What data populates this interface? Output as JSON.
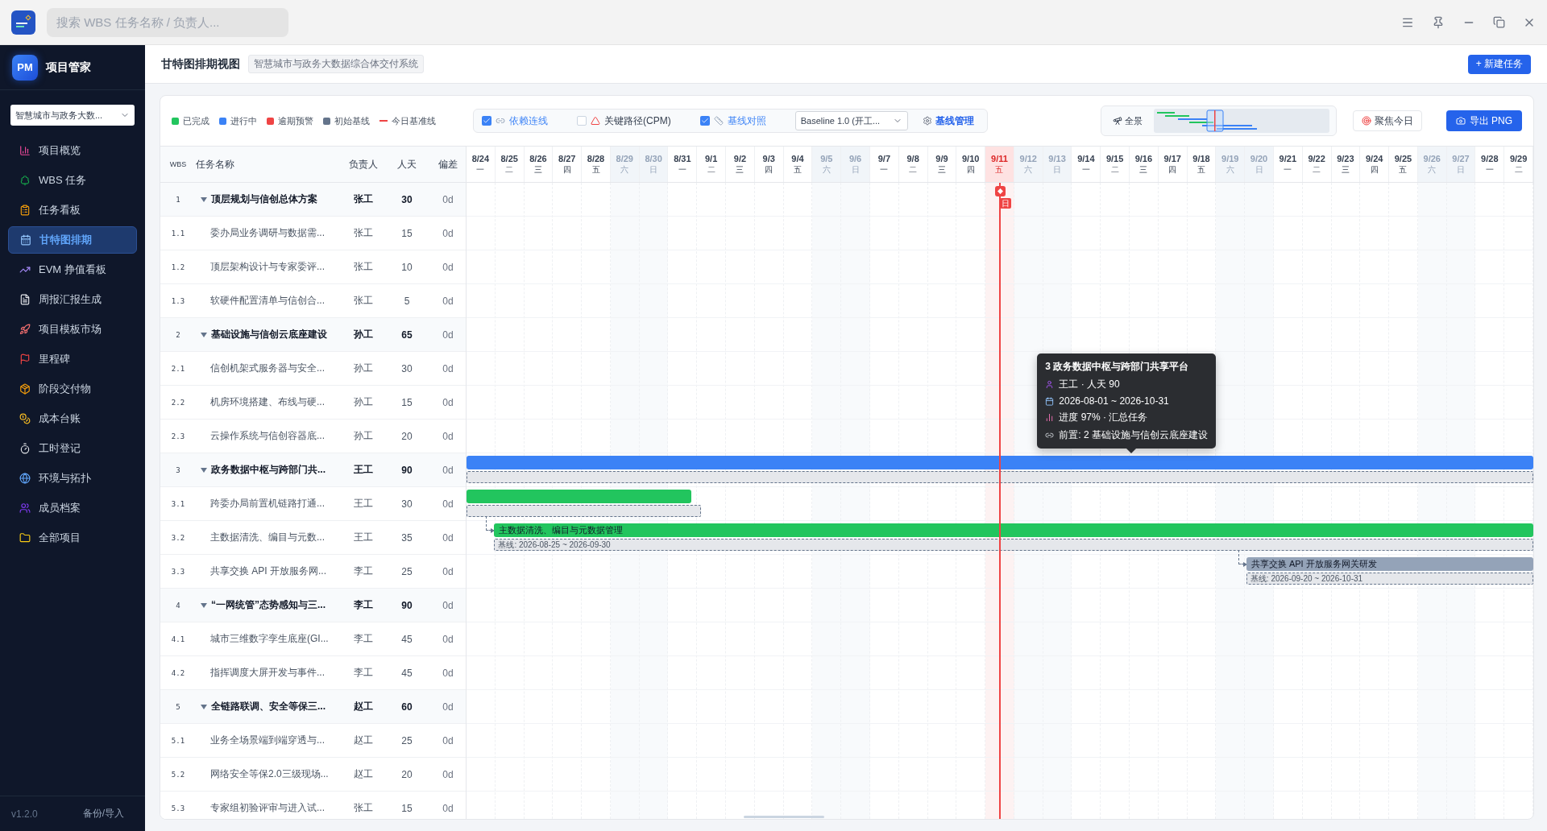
{
  "topbar": {
    "search": {
      "placeholder": "搜索 WBS 任务名称 / 负责人..."
    }
  },
  "sidebar": {
    "brand": {
      "logo": "PM",
      "name": "项目管家"
    },
    "project_select": {
      "value": "智慧城市与政务大数..."
    },
    "items": [
      {
        "label": "项目概览",
        "selected": false
      },
      {
        "label": "WBS 任务",
        "selected": false
      },
      {
        "label": "任务看板",
        "selected": false
      },
      {
        "label": "甘特图排期",
        "selected": true
      },
      {
        "label": "EVM 挣值看板",
        "selected": false
      },
      {
        "label": "周报汇报生成",
        "selected": false
      },
      {
        "label": "项目模板市场",
        "selected": false
      },
      {
        "label": "里程碑",
        "selected": false
      },
      {
        "label": "阶段交付物",
        "selected": false
      },
      {
        "label": "成本台账",
        "selected": false
      },
      {
        "label": "工时登记",
        "selected": false
      },
      {
        "label": "环境与拓扑",
        "selected": false
      },
      {
        "label": "成员档案",
        "selected": false
      },
      {
        "label": "全部项目",
        "selected": false
      }
    ],
    "version": "v1.2.0",
    "backup": "备份/导入"
  },
  "header": {
    "title": "甘特图排期视图",
    "project": "智慧城市与政务大数据综合体交付系统",
    "new_task": "+ 新建任务"
  },
  "legend": [
    {
      "kind": "square",
      "label": "已完成",
      "color": "#22c55e"
    },
    {
      "kind": "square",
      "label": "进行中",
      "color": "#3b82f6"
    },
    {
      "kind": "square",
      "label": "逾期预警",
      "color": "#ef4444"
    },
    {
      "kind": "square",
      "label": "初始基线",
      "color": "#64748b"
    },
    {
      "kind": "line",
      "label": "今日基准线",
      "color": "#ef4444"
    }
  ],
  "toggles": {
    "dependencies": {
      "label": "依赖连线",
      "checked": true
    },
    "critical_path": {
      "label": "关键路径(CPM)",
      "checked": false
    },
    "baseline": {
      "label": "基线对照",
      "checked": true
    }
  },
  "baseline_select": {
    "value": "Baseline 1.0 (开工..."
  },
  "baseline_manage": "基线管理",
  "overview": {
    "label": "全景"
  },
  "focus_today": "聚焦今日",
  "export": "导出 PNG",
  "table": {
    "columns": [
      "WBS",
      "任务名称",
      "负责人",
      "人天",
      "偏差"
    ],
    "rows": [
      {
        "wbs": "1",
        "name": "顶层规划与信创总体方案",
        "owner": "张工",
        "days": "30",
        "variance": "0d",
        "kind": "summary",
        "expanded": true
      },
      {
        "wbs": "1.1",
        "name": "委办局业务调研与数据需...",
        "owner": "张工",
        "days": "15",
        "variance": "0d",
        "kind": "task"
      },
      {
        "wbs": "1.2",
        "name": "顶层架构设计与专家委评...",
        "owner": "张工",
        "days": "10",
        "variance": "0d",
        "kind": "task"
      },
      {
        "wbs": "1.3",
        "name": "软硬件配置清单与信创合...",
        "owner": "张工",
        "days": "5",
        "variance": "0d",
        "kind": "task"
      },
      {
        "wbs": "2",
        "name": "基础设施与信创云底座建设",
        "owner": "孙工",
        "days": "65",
        "variance": "0d",
        "kind": "summary",
        "expanded": true
      },
      {
        "wbs": "2.1",
        "name": "信创机架式服务器与安全...",
        "owner": "孙工",
        "days": "30",
        "variance": "0d",
        "kind": "task"
      },
      {
        "wbs": "2.2",
        "name": "机房环境搭建、布线与硬...",
        "owner": "孙工",
        "days": "15",
        "variance": "0d",
        "kind": "task"
      },
      {
        "wbs": "2.3",
        "name": "云操作系统与信创容器底...",
        "owner": "孙工",
        "days": "20",
        "variance": "0d",
        "kind": "task"
      },
      {
        "wbs": "3",
        "name": "政务数据中枢与跨部门共...",
        "owner": "王工",
        "days": "90",
        "variance": "0d",
        "kind": "summary",
        "expanded": true,
        "bar": {
          "color": "#3b82f6",
          "kind": "left",
          "level": 1,
          "baseline": {
            "kind": "left",
            "level": 1
          }
        }
      },
      {
        "wbs": "3.1",
        "name": "跨委办局前置机链路打通...",
        "owner": "王工",
        "days": "30",
        "variance": "0d",
        "kind": "task",
        "bar": {
          "color": "#22c55e",
          "kind": "left",
          "level": 0.211,
          "baseline": {
            "kind": "left",
            "level": 0.22
          }
        }
      },
      {
        "wbs": "3.2",
        "name": "主数据清洗、编目与元数...",
        "owner": "王工",
        "days": "35",
        "variance": "0d",
        "kind": "task",
        "bar": {
          "color": "#22c55e",
          "kind": "right",
          "level": 0.974,
          "label": "主数据清洗、编目与元数据管理",
          "has_predecessor": true,
          "baseline": {
            "kind": "right",
            "level": 0.974,
            "label": "基线: 2026-08-25 ~ 2026-09-30"
          }
        }
      },
      {
        "wbs": "3.3",
        "name": "共享交换 API 开放服务网...",
        "owner": "李工",
        "days": "25",
        "variance": "0d",
        "kind": "task",
        "bar": {
          "color": "#94a3b8",
          "kind": "right",
          "level": 0.269,
          "label": "共享交换 API 开放服务网关研发",
          "has_predecessor": true,
          "baseline": {
            "kind": "right",
            "level": 0.269,
            "label": "基线: 2026-09-20 ~ 2026-10-31"
          }
        }
      },
      {
        "wbs": "4",
        "name": "“一网统管”态势感知与三...",
        "owner": "李工",
        "days": "90",
        "variance": "0d",
        "kind": "summary",
        "expanded": true
      },
      {
        "wbs": "4.1",
        "name": "城市三维数字孪生底座(GI...",
        "owner": "李工",
        "days": "45",
        "variance": "0d",
        "kind": "task"
      },
      {
        "wbs": "4.2",
        "name": "指挥调度大屏开发与事件...",
        "owner": "李工",
        "days": "45",
        "variance": "0d",
        "kind": "task"
      },
      {
        "wbs": "5",
        "name": "全链路联调、安全等保三...",
        "owner": "赵工",
        "days": "60",
        "variance": "0d",
        "kind": "summary",
        "expanded": true
      },
      {
        "wbs": "5.1",
        "name": "业务全场景端到端穿透与...",
        "owner": "赵工",
        "days": "25",
        "variance": "0d",
        "kind": "task"
      },
      {
        "wbs": "5.2",
        "name": "网络安全等保2.0三级现场...",
        "owner": "赵工",
        "days": "20",
        "variance": "0d",
        "kind": "task"
      },
      {
        "wbs": "5.3",
        "name": "专家组初验评审与进入试...",
        "owner": "张工",
        "days": "15",
        "variance": "0d",
        "kind": "task"
      }
    ]
  },
  "timeline": {
    "days": [
      {
        "date": "8/24",
        "weekday": "一",
        "weekend": false,
        "today": false
      },
      {
        "date": "8/25",
        "weekday": "二",
        "weekend": false,
        "today": false
      },
      {
        "date": "8/26",
        "weekday": "三",
        "weekend": false,
        "today": false
      },
      {
        "date": "8/27",
        "weekday": "四",
        "weekend": false,
        "today": false
      },
      {
        "date": "8/28",
        "weekday": "五",
        "weekend": false,
        "today": false
      },
      {
        "date": "8/29",
        "weekday": "六",
        "weekend": true,
        "today": false
      },
      {
        "date": "8/30",
        "weekday": "日",
        "weekend": true,
        "today": false
      },
      {
        "date": "8/31",
        "weekday": "一",
        "weekend": false,
        "today": false
      },
      {
        "date": "9/1",
        "weekday": "二",
        "weekend": false,
        "today": false
      },
      {
        "date": "9/2",
        "weekday": "三",
        "weekend": false,
        "today": false
      },
      {
        "date": "9/3",
        "weekday": "四",
        "weekend": false,
        "today": false
      },
      {
        "date": "9/4",
        "weekday": "五",
        "weekend": false,
        "today": false
      },
      {
        "date": "9/5",
        "weekday": "六",
        "weekend": true,
        "today": false
      },
      {
        "date": "9/6",
        "weekday": "日",
        "weekend": true,
        "today": false
      },
      {
        "date": "9/7",
        "weekday": "一",
        "weekend": false,
        "today": false
      },
      {
        "date": "9/8",
        "weekday": "二",
        "weekend": false,
        "today": false
      },
      {
        "date": "9/9",
        "weekday": "三",
        "weekend": false,
        "today": false
      },
      {
        "date": "9/10",
        "weekday": "四",
        "weekend": false,
        "today": false
      },
      {
        "date": "9/11",
        "weekday": "五",
        "weekend": false,
        "today": true
      },
      {
        "date": "9/12",
        "weekday": "六",
        "weekend": true,
        "today": false
      },
      {
        "date": "9/13",
        "weekday": "日",
        "weekend": true,
        "today": false
      },
      {
        "date": "9/14",
        "weekday": "一",
        "weekend": false,
        "today": false
      },
      {
        "date": "9/15",
        "weekday": "二",
        "weekend": false,
        "today": false
      },
      {
        "date": "9/16",
        "weekday": "三",
        "weekend": false,
        "today": false
      },
      {
        "date": "9/17",
        "weekday": "四",
        "weekend": false,
        "today": false
      },
      {
        "date": "9/18",
        "weekday": "五",
        "weekend": false,
        "today": false
      },
      {
        "date": "9/19",
        "weekday": "六",
        "weekend": true,
        "today": false
      },
      {
        "date": "9/20",
        "weekday": "日",
        "weekend": true,
        "today": false
      },
      {
        "date": "9/21",
        "weekday": "一",
        "weekend": false,
        "today": false
      },
      {
        "date": "9/22",
        "weekday": "二",
        "weekend": false,
        "today": false
      },
      {
        "date": "9/23",
        "weekday": "三",
        "weekend": false,
        "today": false
      },
      {
        "date": "9/24",
        "weekday": "四",
        "weekend": false,
        "today": false
      },
      {
        "date": "9/25",
        "weekday": "五",
        "weekend": false,
        "today": false
      },
      {
        "date": "9/26",
        "weekday": "六",
        "weekend": true,
        "today": false
      },
      {
        "date": "9/27",
        "weekday": "日",
        "weekend": true,
        "today": false
      },
      {
        "date": "9/28",
        "weekday": "一",
        "weekend": false,
        "today": false
      },
      {
        "date": "9/29",
        "weekday": "二",
        "weekend": false,
        "today": false
      }
    ],
    "today_tag": "日"
  },
  "tooltip": {
    "title": "3 政务数据中枢与跨部门共享平台",
    "lines": [
      {
        "kind": "person",
        "text": "王工 · 人天 90"
      },
      {
        "kind": "calendar",
        "text": "2026-08-01 ~ 2026-10-31"
      },
      {
        "kind": "chart",
        "text": "进度 97% · 汇总任务"
      },
      {
        "kind": "link",
        "text": "前置: 2 基础设施与信创云底座建设"
      }
    ]
  }
}
